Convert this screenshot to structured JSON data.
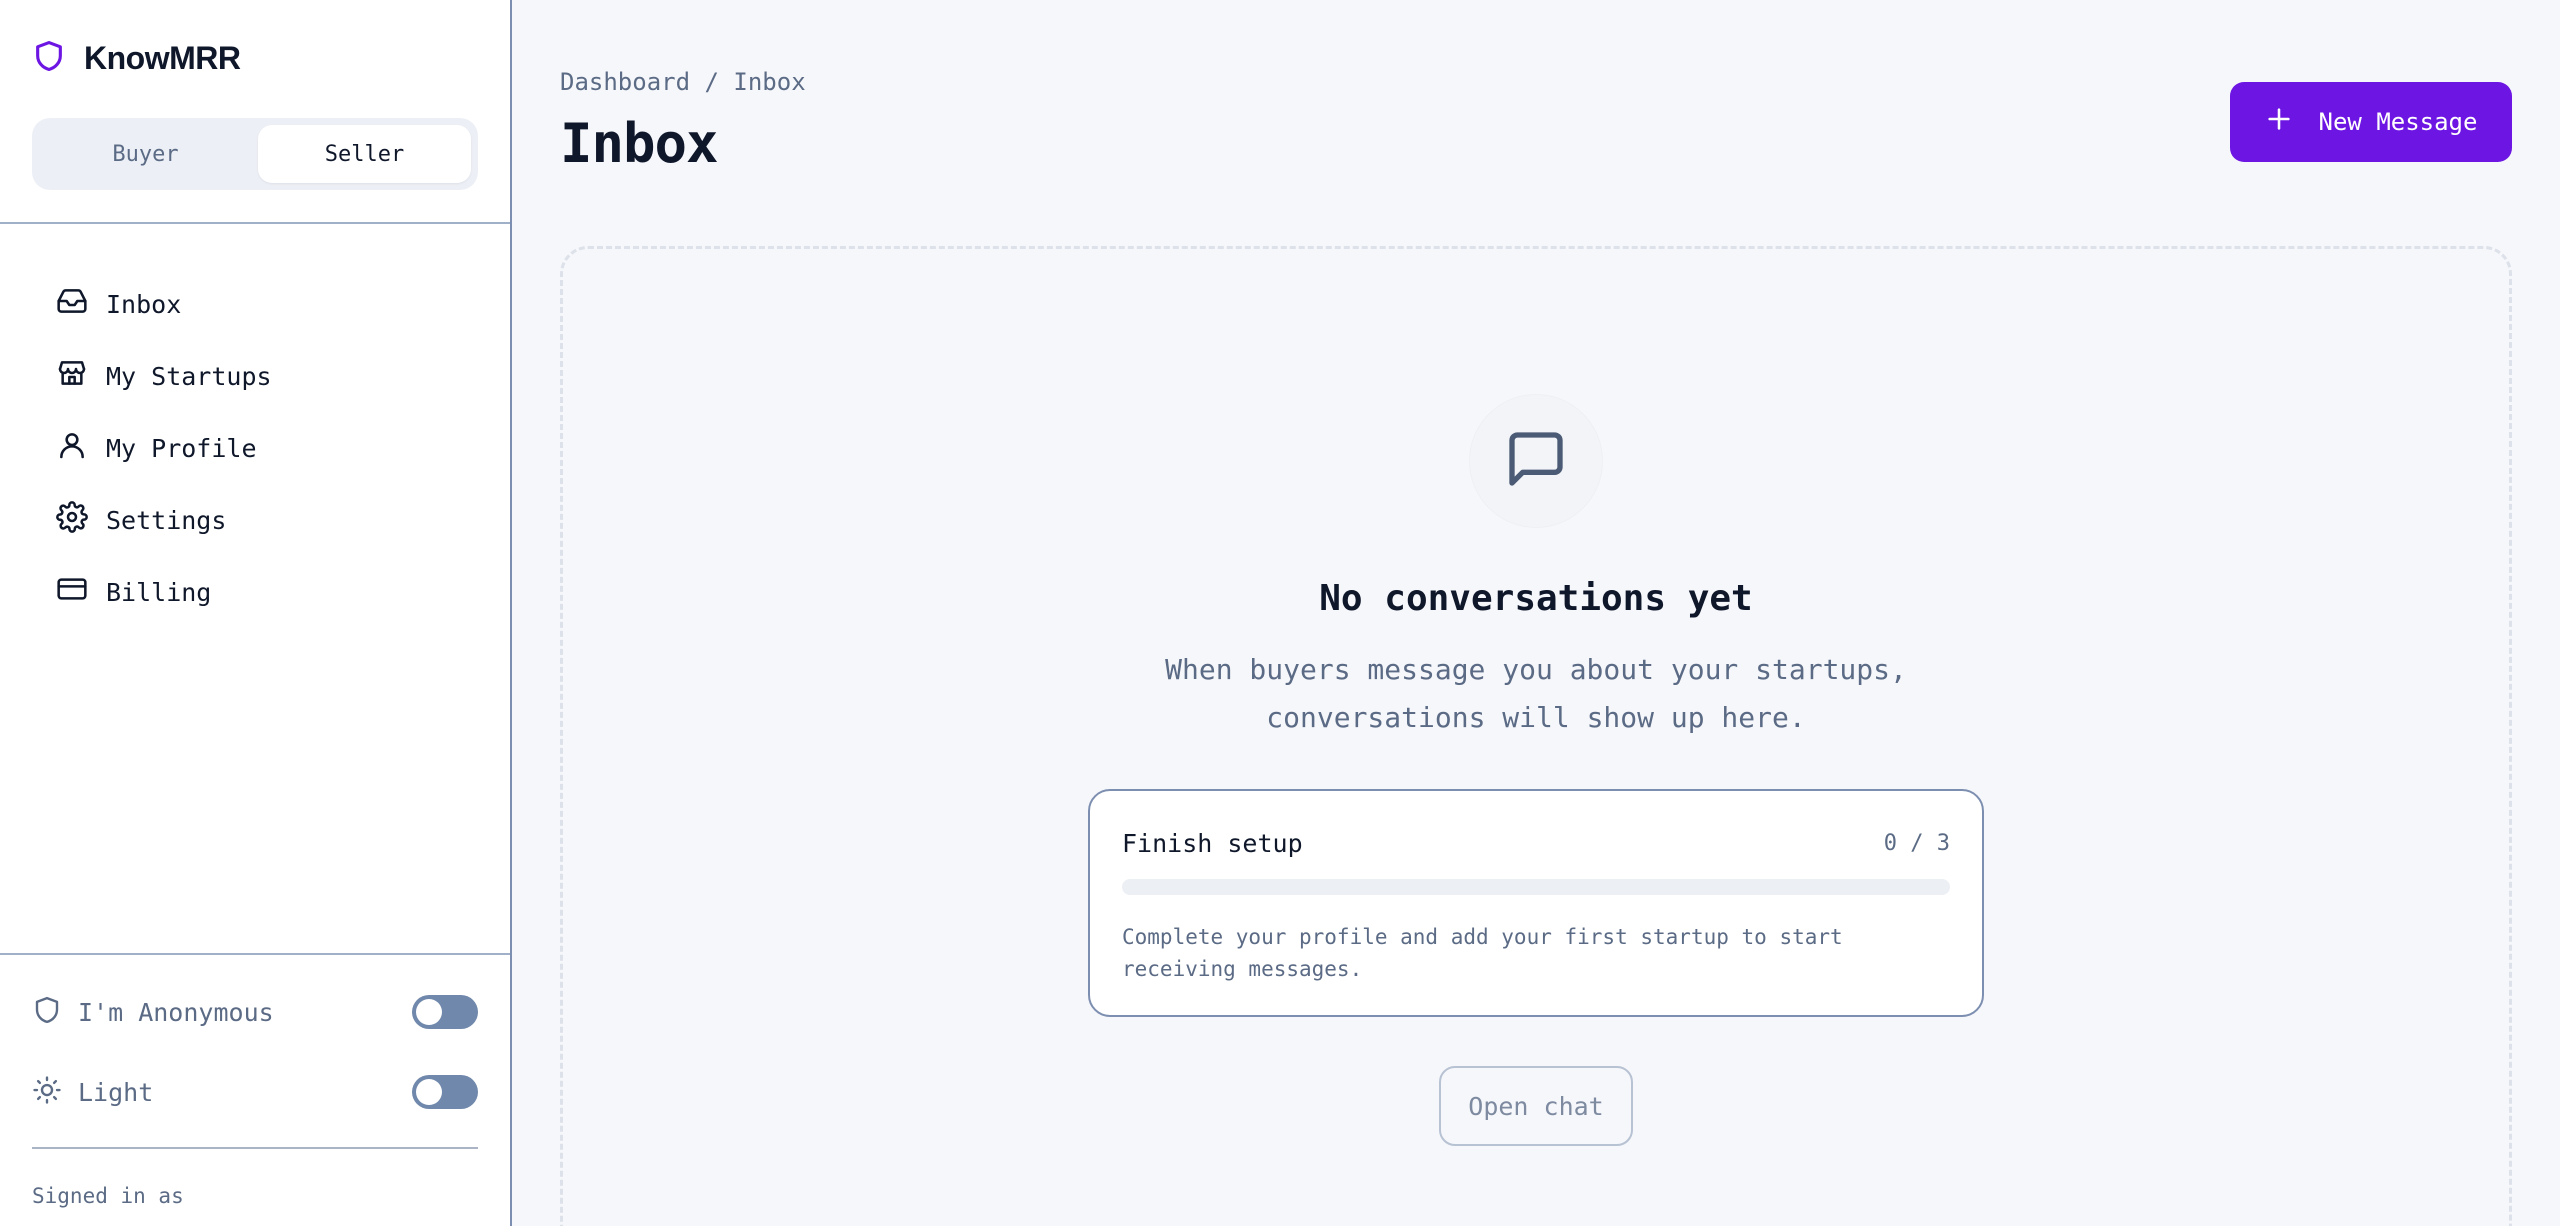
{
  "brand": {
    "name": "KnowMRR",
    "icon": "shield-icon",
    "accent": "#6d16e3"
  },
  "role_toggle": {
    "buyer": "Buyer",
    "seller": "Seller",
    "active": "Seller"
  },
  "nav": {
    "items": [
      {
        "label": "Inbox",
        "icon": "inbox-icon"
      },
      {
        "label": "My Startups",
        "icon": "store-icon"
      },
      {
        "label": "My Profile",
        "icon": "user-icon"
      },
      {
        "label": "Settings",
        "icon": "gear-icon"
      },
      {
        "label": "Billing",
        "icon": "credit-card-icon"
      }
    ]
  },
  "toggles": {
    "anonymous": {
      "label": "I'm Anonymous",
      "icon": "shield-icon",
      "on": false
    },
    "theme": {
      "label": "Light",
      "icon": "sun-icon",
      "on": false
    }
  },
  "footer": {
    "signed_in_label": "Signed in as"
  },
  "header": {
    "breadcrumb": "Dashboard / Inbox",
    "title": "Inbox",
    "new_message_label": "New Message"
  },
  "empty_state": {
    "icon": "message-square-icon",
    "title": "No conversations yet",
    "description": "When buyers message you about your startups, conversations will show up here."
  },
  "setup": {
    "title": "Finish setup",
    "count": "0 / 3",
    "progress": 0,
    "description": "Complete your profile and add your first startup to start receiving messages."
  },
  "open_chat_label": "Open chat"
}
